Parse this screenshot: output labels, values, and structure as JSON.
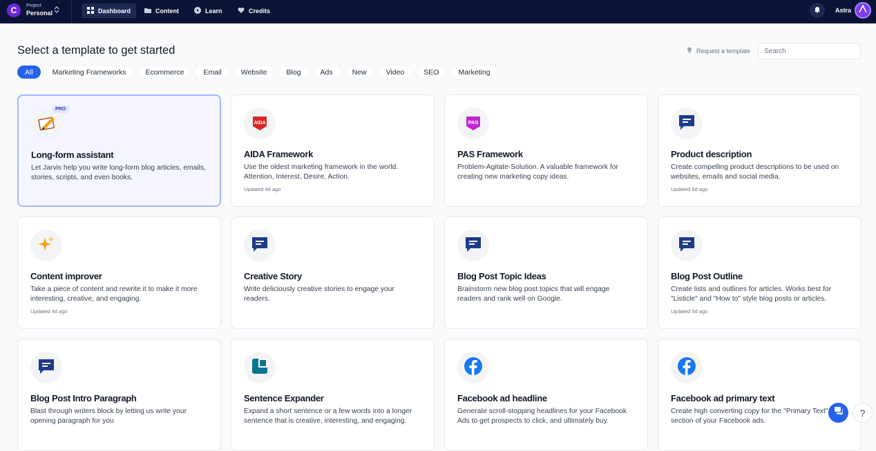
{
  "app": {
    "logo_letter": "C",
    "project_label": "Project",
    "project_name": "Personal",
    "user_name": "Astra"
  },
  "nav": [
    {
      "label": "Dashboard",
      "icon": "dashboard-icon",
      "active": true
    },
    {
      "label": "Content",
      "icon": "folder-icon",
      "active": false
    },
    {
      "label": "Learn",
      "icon": "play-icon",
      "active": false
    },
    {
      "label": "Credits",
      "icon": "heart-icon",
      "active": false
    }
  ],
  "header": {
    "title": "Select a template to get started",
    "request_label": "Request a template",
    "search_placeholder": "Search"
  },
  "tabs": [
    "All",
    "Marketing Frameworks",
    "Ecommerce",
    "Email",
    "Website",
    "Blog",
    "Ads",
    "New",
    "Video",
    "SEO",
    "Marketing"
  ],
  "active_tab": "All",
  "cards": [
    {
      "title": "Long-form assistant",
      "desc": "Let Jarvis help you write long-form blog articles, emails, stories, scripts, and even books.",
      "updated": "",
      "icon": "pen-paper-icon",
      "pro": "PRO"
    },
    {
      "title": "AIDA Framework",
      "desc": "Use the oldest marketing framework in the world. Attention, Interest, Desire, Action.",
      "updated": "Updated 4d ago",
      "icon": "aida-badge-icon",
      "pro": ""
    },
    {
      "title": "PAS Framework",
      "desc": "Problem-Agitate-Solution. A valuable framework for creating new marketing copy ideas.",
      "updated": "",
      "icon": "pas-badge-icon",
      "pro": ""
    },
    {
      "title": "Product description",
      "desc": "Create compelling product descriptions to be used on websites, emails and social media.",
      "updated": "Updated 6d ago",
      "icon": "chat-bubble-icon",
      "pro": ""
    },
    {
      "title": "Content improver",
      "desc": "Take a piece of content and rewrite it to make it more interesting, creative, and engaging.",
      "updated": "Updated 4d ago",
      "icon": "sparkles-icon",
      "pro": ""
    },
    {
      "title": "Creative Story",
      "desc": "Write deliciously creative stories to engage your readers.",
      "updated": "",
      "icon": "chat-bubble-icon",
      "pro": ""
    },
    {
      "title": "Blog Post Topic Ideas",
      "desc": "Brainstorm new blog post topics that will engage readers and rank well on Google.",
      "updated": "",
      "icon": "chat-bubble-icon",
      "pro": ""
    },
    {
      "title": "Blog Post Outline",
      "desc": "Create lists and outlines for articles. Works best for \"Listicle\" and \"How to\" style blog posts or articles.",
      "updated": "Updated 5d ago",
      "icon": "chat-bubble-icon",
      "pro": ""
    },
    {
      "title": "Blog Post Intro Paragraph",
      "desc": "Blast through writers block by letting us write your opening paragraph for you",
      "updated": "",
      "icon": "chat-bubble-icon",
      "pro": ""
    },
    {
      "title": "Sentence Expander",
      "desc": "Expand a short sentence or a few words into a longer sentence that is creative, interesting, and engaging.",
      "updated": "",
      "icon": "expand-box-icon",
      "pro": ""
    },
    {
      "title": "Facebook ad headline",
      "desc": "Generate scroll-stopping headlines for your Facebook Ads to get prospects to click, and ultimately buy.",
      "updated": "",
      "icon": "facebook-icon",
      "pro": ""
    },
    {
      "title": "Facebook ad primary text",
      "desc": "Create high converting copy for the \"Primary Text\" section of your Facebook ads.",
      "updated": "",
      "icon": "facebook-icon",
      "pro": ""
    }
  ],
  "colors": {
    "nav_bg": "#0b1437",
    "accent": "#2563eb",
    "icon_blue": "#1e3a8a"
  }
}
